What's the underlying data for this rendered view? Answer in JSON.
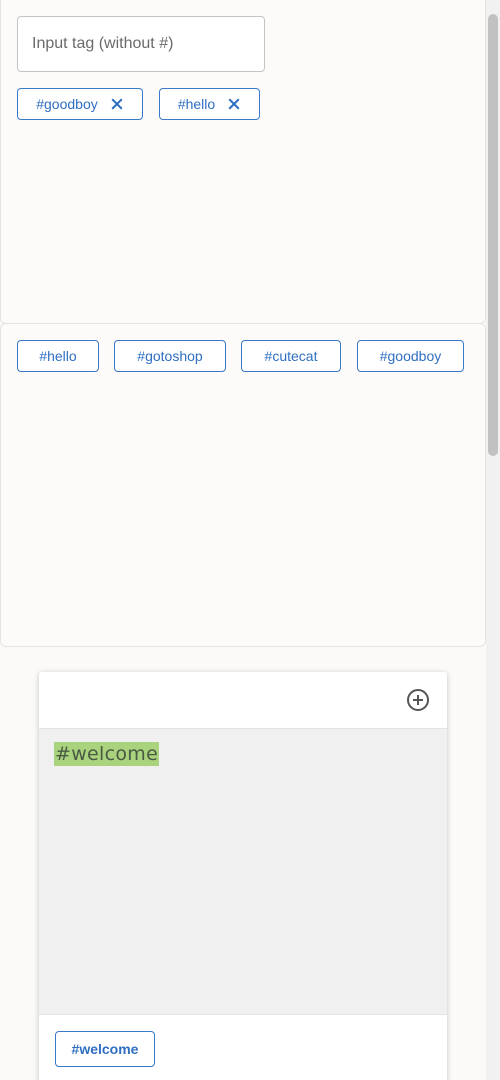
{
  "input": {
    "placeholder": "Input tag (without #)",
    "value": ""
  },
  "selected_tags": [
    {
      "label": "#goodboy"
    },
    {
      "label": "#hello"
    }
  ],
  "suggested_tags": [
    {
      "label": "#hello"
    },
    {
      "label": "#gotoshop"
    },
    {
      "label": "#cutecat"
    },
    {
      "label": "#goodboy"
    }
  ],
  "card": {
    "add_icon": "add-circle-icon",
    "editor_text": "#welcome",
    "footer_tag": "#welcome"
  },
  "colors": {
    "accent": "#2f6fc2",
    "hashtag_highlight": "#a9d37c",
    "editor_bg": "#f0f0f0"
  }
}
